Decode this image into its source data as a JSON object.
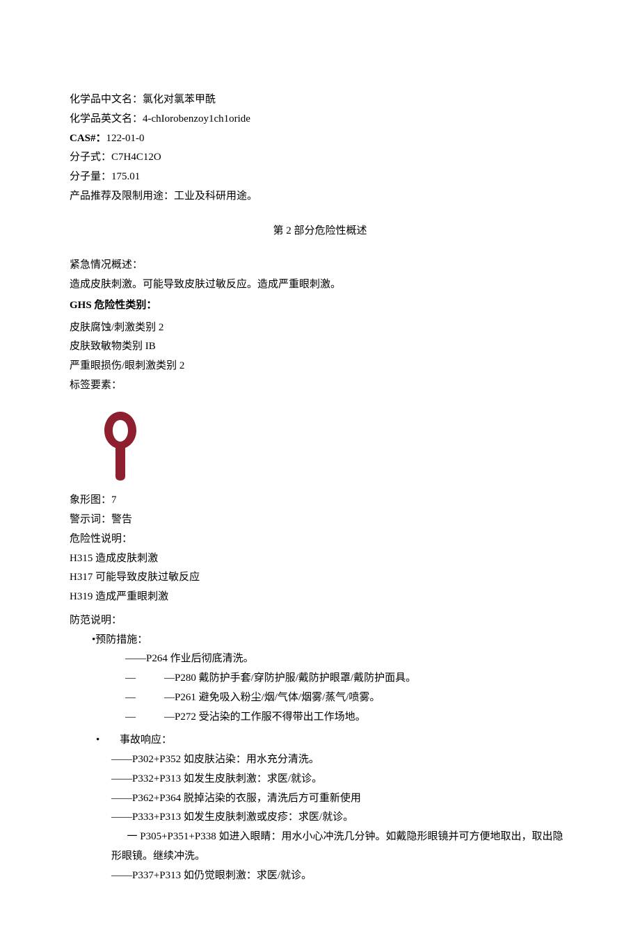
{
  "identity": {
    "cn_name_label": "化学品中文名：",
    "cn_name_value": "氯化对氯苯甲酰",
    "en_name_label": "化学品英文名：",
    "en_name_value": "4-chIorobenzoy1ch1oride",
    "cas_label": "CAS#：",
    "cas_value": "122-01-0",
    "formula_label": "分子式：",
    "formula_value": "C7H4C12O",
    "mw_label": "分子量：",
    "mw_value": "175.01",
    "use_label": "产品推荐及限制用途：",
    "use_value": "工业及科研用途。"
  },
  "section2": {
    "title": "第 2 部分危险性概述",
    "emergency_label": "紧急情况概述：",
    "emergency_text": "造成皮肤刺激。可能导致皮肤过敏反应。造成严重眼刺激。",
    "ghs_label": "GHS 危险性类别：",
    "ghs_cat1": "皮肤腐蚀/刺激类别 2",
    "ghs_cat2": "皮肤致敏物类别 IB",
    "ghs_cat3": "严重眼损伤/眼刺激类别 2",
    "label_elements": "标签要素：",
    "pictogram_label": "象形图：",
    "pictogram_value": "7",
    "signal_label": "警示词：",
    "signal_value": "警告",
    "hazard_label": "危险性说明：",
    "h315": "H315 造成皮肤刺激",
    "h317": "H317 可能导致皮肤过敏反应",
    "h319": "H319 造成严重眼刺激",
    "precaution_label": "防范说明：",
    "prevention_label": "•预防措施：",
    "p264": "——P264 作业后彻底清洗。",
    "p280_dash1": "—",
    "p280_text": "—P280 戴防护手套/穿防护服/戴防护眼罩/戴防护面具。",
    "p261_dash1": "—",
    "p261_text": "—P261 避免吸入粉尘/烟/气体/烟雾/蒸气/喷雾。",
    "p272_dash1": "—",
    "p272_text": "—P272 受沾染的工作服不得带出工作场地。",
    "response_bullet": "•",
    "response_label": "事故响应：",
    "r1": "——P302+P352 如皮肤沾染：用水充分清洗。",
    "r2": "——P332+P313 如发生皮肤刺激：求医/就诊。",
    "r3": "——P362+P364 脱掉沾染的衣服，清洗后方可重新使用",
    "r4": "——P333+P313 如发生皮肤刺激或皮疹：求医/就诊。",
    "r5": "一 P305+P351+P338 如进入眼睛：用水小心冲洗几分钟。如戴隐形眼镜并可方便地取出，取出隐形眼镜。继续冲洗。",
    "r6": "——P337+P313 如仍觉眼刺激：求医/就诊。"
  }
}
